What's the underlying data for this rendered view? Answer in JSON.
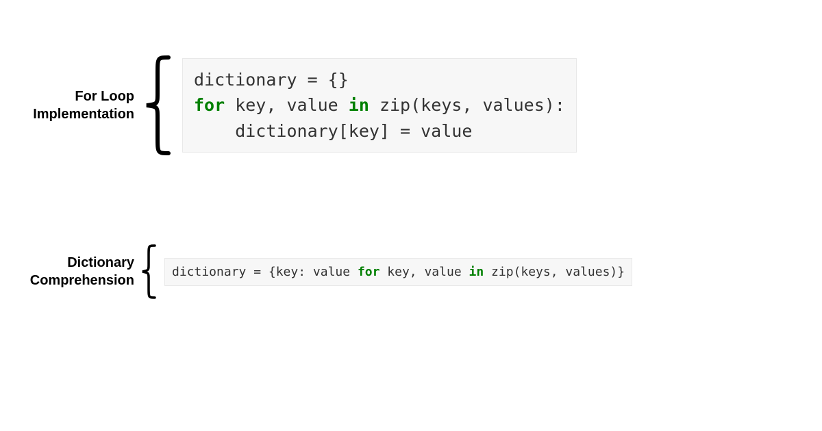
{
  "labels": {
    "forloop": "For Loop\nImplementation",
    "dictcomp": "Dictionary\nComprehension"
  },
  "code1": {
    "line1_a": "dictionary = {}",
    "line2_kw1": "for",
    "line2_mid": " key, value ",
    "line2_kw2": "in",
    "line2_end": " zip(keys, values):",
    "line3": "    dictionary[key] = value"
  },
  "code2": {
    "pre": "dictionary = {key: value ",
    "kw1": "for",
    "mid": " key, value ",
    "kw2": "in",
    "end": " zip(keys, values)}"
  }
}
